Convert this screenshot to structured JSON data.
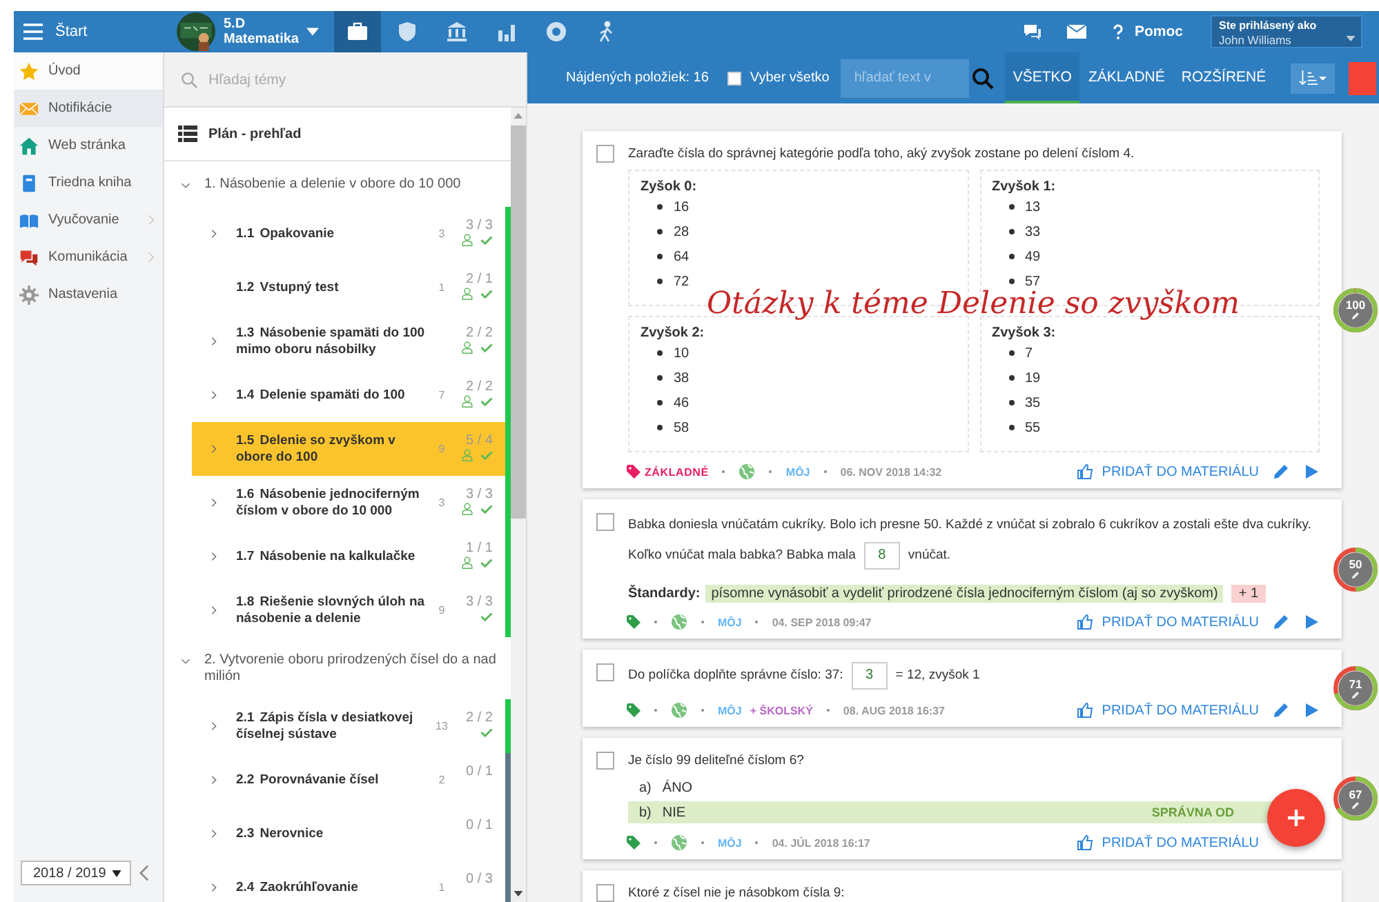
{
  "topbar": {
    "menu_label": "Štart",
    "class_name": "5.D",
    "subject": "Matematika",
    "nav_icons": [
      {
        "kind": "briefcase",
        "selected": true
      },
      {
        "kind": "shield",
        "selected": false
      },
      {
        "kind": "bank",
        "selected": false
      },
      {
        "kind": "bars",
        "selected": false
      },
      {
        "kind": "badge",
        "selected": false
      },
      {
        "kind": "walker",
        "selected": false
      }
    ],
    "help": "Pomoc",
    "user_caption": "Ste prihlásený ako",
    "user_name": "John Williams"
  },
  "sidebar": {
    "items": [
      {
        "kind": "star",
        "label": "Úvod",
        "selected": false,
        "submenu": false
      },
      {
        "kind": "mail",
        "label": "Notifikácie",
        "selected": true,
        "submenu": false
      },
      {
        "kind": "house",
        "label": "Web stránka",
        "selected": false,
        "submenu": false
      },
      {
        "kind": "book",
        "label": "Triedna kniha",
        "selected": false,
        "submenu": false
      },
      {
        "kind": "openbook",
        "label": "Vyučovanie",
        "selected": false,
        "submenu": true
      },
      {
        "kind": "chat",
        "label": "Komunikácia",
        "selected": false,
        "submenu": true
      },
      {
        "kind": "gear",
        "label": "Nastavenia",
        "selected": false,
        "submenu": false
      }
    ],
    "year": "2018 / 2019"
  },
  "topics": {
    "search_placeholder": "Hľadaj témy",
    "overview": "Plán - prehľad",
    "groups": [
      {
        "title": "1. Násobenie a delenie v obore do 10 000",
        "expanded": true,
        "children": [
          {
            "number": "1.1",
            "title": "Opakovanie",
            "count": "3",
            "score": "3 / 3",
            "expandable": true,
            "locked": true,
            "done": true,
            "selected": false,
            "color": "#1ec94c"
          },
          {
            "number": "1.2",
            "title": "Vstupný test",
            "count": "1",
            "score": "2 / 1",
            "expandable": false,
            "locked": true,
            "done": true,
            "selected": false,
            "color": "#1ec94c"
          },
          {
            "number": "1.3",
            "title": "Násobenie spamäti do 100 mimo oboru násobilky",
            "score": "2 / 2",
            "expandable": true,
            "locked": true,
            "done": true,
            "selected": false,
            "color": "#1ec94c"
          },
          {
            "number": "1.4",
            "title": "Delenie spamäti do 100",
            "count": "7",
            "score": "2 / 2",
            "expandable": true,
            "locked": true,
            "done": true,
            "selected": false,
            "color": "#1ec94c"
          },
          {
            "number": "1.5",
            "title": "Delenie so zvyškom v obore do 100",
            "count": "9",
            "score": "5 / 4",
            "expandable": true,
            "locked": true,
            "done": true,
            "selected": true,
            "color": "#1ec94c"
          },
          {
            "number": "1.6",
            "title": "Násobenie jednociferným číslom v obore do 10 000",
            "count": "3",
            "score": "3 / 3",
            "expandable": true,
            "locked": true,
            "done": true,
            "selected": false,
            "color": "#1ec94c"
          },
          {
            "number": "1.7",
            "title": "Násobenie na kalkulačke",
            "score": "1 / 1",
            "expandable": true,
            "locked": true,
            "done": true,
            "selected": false,
            "color": "#1ec94c"
          },
          {
            "number": "1.8",
            "title": "Riešenie slovných úloh na násobenie a delenie",
            "count": "9",
            "score": "3 / 3",
            "expandable": true,
            "locked": false,
            "done": true,
            "selected": false,
            "color": "#1ec94c"
          }
        ]
      },
      {
        "title": "2. Vytvorenie oboru prirodzených čísel do a nad milión",
        "expanded": true,
        "children": [
          {
            "number": "2.1",
            "title": "Zápis čísla v desiatkovej číselnej sústave",
            "count": "13",
            "score": "2 / 2",
            "expandable": true,
            "locked": false,
            "done": true,
            "selected": false,
            "color": "#1ec94c"
          },
          {
            "number": "2.2",
            "title": "Porovnávanie čísel",
            "count": "2",
            "score": "0 / 1",
            "expandable": true,
            "locked": false,
            "done": false,
            "selected": false,
            "color": "#5e7888"
          },
          {
            "number": "2.3",
            "title": "Nerovnice",
            "score": "0 / 1",
            "expandable": true,
            "locked": false,
            "done": false,
            "selected": false,
            "color": "#5e7888"
          },
          {
            "number": "2.4",
            "title": "Zaokrúhľovanie",
            "count": "1",
            "score": "0 / 3",
            "expandable": true,
            "locked": false,
            "done": false,
            "selected": false,
            "color": "#5e7888"
          }
        ]
      }
    ]
  },
  "toolbar": {
    "found": "Nájdených položiek: 16",
    "select_all": {
      "label": "Vyber všetko",
      "checked": false
    },
    "search_placeholder": "hľadať text v",
    "filters": [
      {
        "label": "VŠETKO",
        "selected": true
      },
      {
        "label": "ZÁKLADNÉ",
        "selected": false
      },
      {
        "label": "ROZŠÍRENÉ",
        "selected": false
      }
    ]
  },
  "annotation": "Otázky k téme Delenie so zvyškom",
  "questions": [
    {
      "kind": "categories",
      "checked": false,
      "text": "Zaraďte čísla do správnej kategórie podľa toho, aký zvyšok zostane po delení číslom 4.",
      "categories": [
        {
          "title": "Zyšok 0:",
          "items": [
            "16",
            "28",
            "64",
            "72"
          ]
        },
        {
          "title": "Zvyšok 1:",
          "items": [
            "13",
            "33",
            "49",
            "57"
          ]
        },
        {
          "title": "Zvyšok 2:",
          "items": [
            "10",
            "38",
            "46",
            "58"
          ]
        },
        {
          "title": "Zvyšok 3:",
          "items": [
            "7",
            "19",
            "35",
            "55"
          ]
        }
      ],
      "tag": "ZÁKLADNÉ",
      "owner": "MÔJ",
      "date": "06. NOV 2018 14:32",
      "add_label": "PRIDAŤ DO MATERIÁLU",
      "editable": true,
      "score": {
        "reading": "100",
        "level": 1
      }
    },
    {
      "kind": "fill_in",
      "checked": false,
      "before": [
        "Babka doniesla vnúčatám cukríky. Bolo ich presne 50. Každé z vnúčat si zobralo 6 cukríkov a zostali ešte dva cukríky.",
        "Koľko vnúčat mala babka? Babka mala"
      ],
      "answer": "8",
      "after": "vnúčat.",
      "standards": {
        "label": "Štandardy:",
        "items": [
          "písomne vynásobiť a vydeliť prirodzené čísla jednociferným číslom (aj so zvyškom)"
        ],
        "more": "+ 1"
      },
      "owner": "MÔJ",
      "date": "04. SEP 2018 09:47",
      "add_label": "PRIDAŤ DO MATERIÁLU",
      "editable": true,
      "score": {
        "reading": "50",
        "level": 0.5
      }
    },
    {
      "kind": "fill_in",
      "checked": false,
      "before": [
        "Do políčka doplňte správne číslo: 37:"
      ],
      "answer": "3",
      "after": "= 12, zvyšok 1",
      "owner": "MÔJ",
      "shared": "+ ŠKOLSKÝ",
      "date": "08. AUG 2018 16:37",
      "add_label": "PRIDAŤ DO MATERIÁLU",
      "editable": true,
      "score": {
        "reading": "71",
        "level": 0.71
      }
    },
    {
      "kind": "choice",
      "checked": false,
      "text": "Je číslo 99 deliteľné číslom 6?",
      "options": [
        {
          "letter": "a)",
          "text": "ÁNO",
          "correct": false
        },
        {
          "letter": "b)",
          "text": "NIE",
          "correct": true
        }
      ],
      "correct_label": "SPRÁVNA OD",
      "owner": "MÔJ",
      "date": "04. JÚL 2018 16:17",
      "add_label": "PRIDAŤ DO MATERIÁLU",
      "editable": false,
      "score": {
        "reading": "67",
        "level": 0.67
      }
    },
    {
      "kind": "text",
      "checked": false,
      "text": "Ktoré z čísel nie je násobkom čísla 9:"
    }
  ]
}
